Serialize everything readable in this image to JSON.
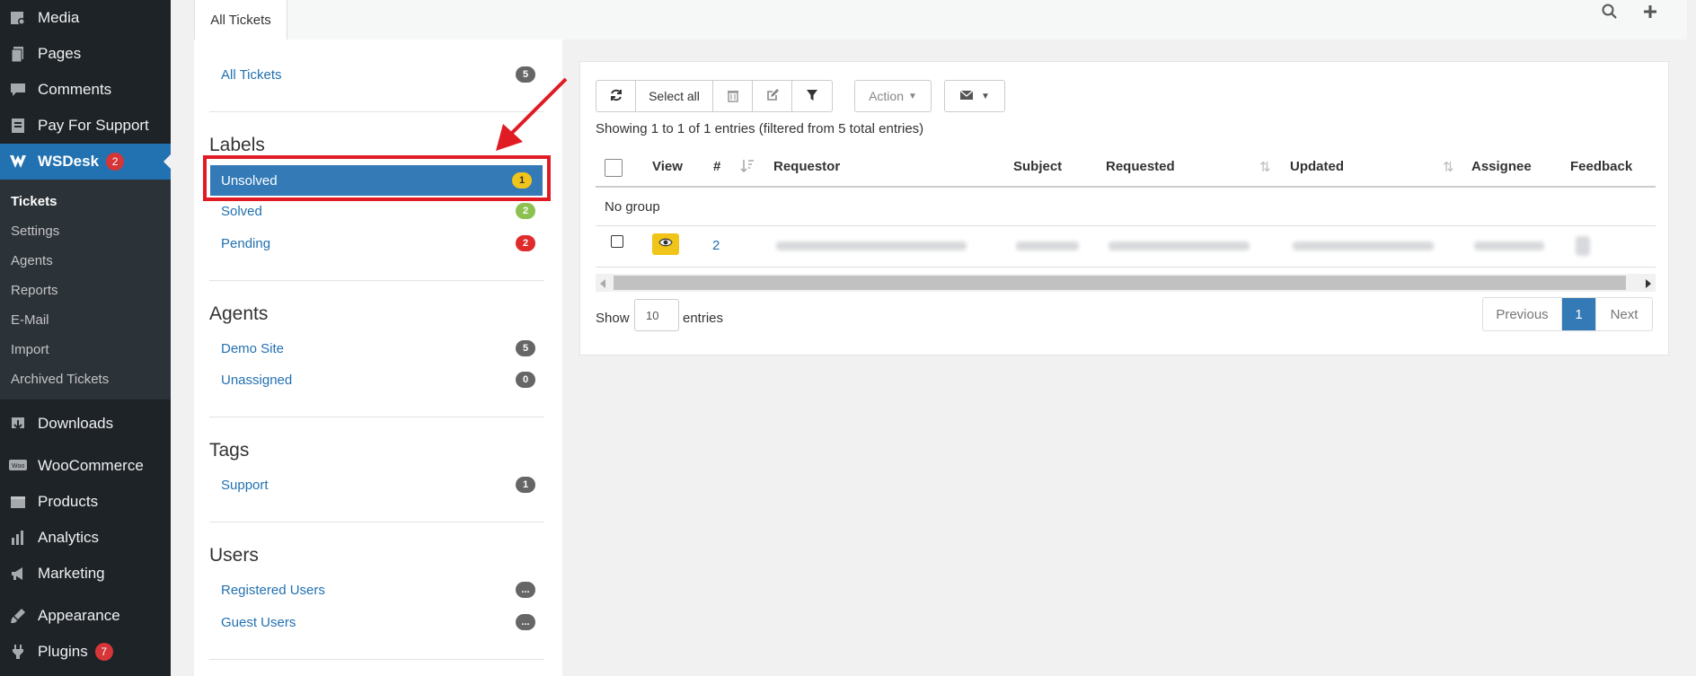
{
  "admin_menu": {
    "top_items": [
      {
        "label": "Media",
        "icon": "media-icon"
      },
      {
        "label": "Pages",
        "icon": "pages-icon"
      },
      {
        "label": "Comments",
        "icon": "comments-icon"
      },
      {
        "label": "Pay For Support",
        "icon": "pay-support-icon"
      }
    ],
    "wsdesk": {
      "label": "WSDesk",
      "badge": "2"
    },
    "submenu": [
      "Tickets",
      "Settings",
      "Agents",
      "Reports",
      "E-Mail",
      "Import",
      "Archived Tickets"
    ],
    "bottom_items": [
      {
        "label": "Downloads",
        "icon": "downloads-icon"
      },
      {
        "label": "WooCommerce",
        "icon": "woocommerce-icon"
      },
      {
        "label": "Products",
        "icon": "products-icon"
      },
      {
        "label": "Analytics",
        "icon": "analytics-icon"
      },
      {
        "label": "Marketing",
        "icon": "marketing-icon"
      },
      {
        "label": "Appearance",
        "icon": "appearance-icon"
      },
      {
        "label": "Plugins",
        "icon": "plugins-icon",
        "badge": "7"
      }
    ]
  },
  "tabbar": {
    "active_tab": "All Tickets"
  },
  "filters": {
    "all_tickets": {
      "label": "All Tickets",
      "count": "5"
    },
    "labels_heading": "Labels",
    "labels": [
      {
        "label": "Unsolved",
        "count": "1",
        "color": "#f0c419"
      },
      {
        "label": "Solved",
        "count": "2",
        "color": "#8cc152"
      },
      {
        "label": "Pending",
        "count": "2",
        "color": "#e02b2b"
      }
    ],
    "agents_heading": "Agents",
    "agents": [
      {
        "label": "Demo Site",
        "count": "5"
      },
      {
        "label": "Unassigned",
        "count": "0"
      }
    ],
    "tags_heading": "Tags",
    "tags": [
      {
        "label": "Support",
        "count": "1"
      }
    ],
    "users_heading": "Users",
    "users": [
      {
        "label": "Registered Users",
        "count": "..."
      },
      {
        "label": "Guest Users",
        "count": "..."
      }
    ]
  },
  "toolbar": {
    "select_all": "Select all",
    "action": "Action"
  },
  "table": {
    "info": "Showing 1 to 1 of 1 entries (filtered from 5 total entries)",
    "columns": [
      "View",
      "#",
      "Requestor",
      "Subject",
      "Requested",
      "Updated",
      "Assignee",
      "Feedback"
    ],
    "group_label": "No group",
    "row": {
      "number": "2"
    },
    "show_label": "Show",
    "entries_value": "10",
    "entries_label": "entries"
  },
  "pagination": {
    "previous": "Previous",
    "page": "1",
    "next": "Next"
  },
  "colors": {
    "accent": "#337ab7",
    "highlight": "#e01b24",
    "view_button": "#f0c419"
  }
}
